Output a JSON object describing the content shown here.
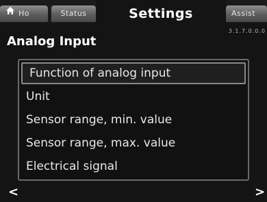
{
  "tabs": {
    "home_label": "Ho",
    "status_label": "Status",
    "active_label": "Settings",
    "assist_label": "Assist"
  },
  "version": "3.1.7.0.0.0",
  "page_title": "Analog Input",
  "menu": {
    "items": [
      {
        "label": "Function of analog input",
        "selected": true
      },
      {
        "label": "Unit",
        "selected": false
      },
      {
        "label": "Sensor range, min. value",
        "selected": false
      },
      {
        "label": "Sensor range, max. value",
        "selected": false
      },
      {
        "label": "Electrical signal",
        "selected": false
      }
    ]
  },
  "nav": {
    "left_icon": "chevron-left",
    "right_icon": "chevron-right",
    "left_glyph": "<",
    "right_glyph": ">"
  },
  "colors": {
    "background": "#141414",
    "tab_gradient_top": "#8f8f8f",
    "text": "#ffffff",
    "menu_border": "#6a6a6a"
  }
}
